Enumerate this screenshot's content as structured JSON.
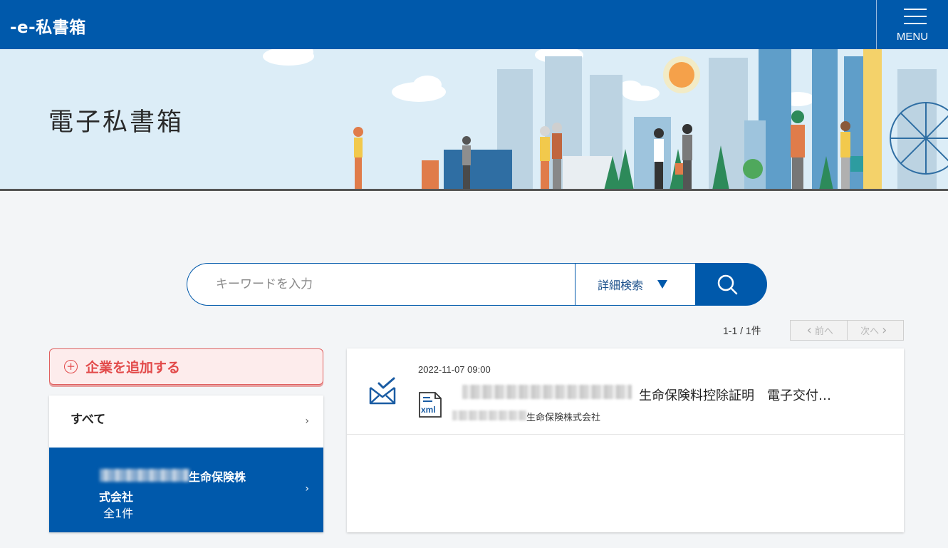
{
  "header": {
    "logo": "-e-私書箱",
    "menu_label": "MENU"
  },
  "hero": {
    "title": "電子私書箱"
  },
  "search": {
    "placeholder": "キーワードを入力",
    "detail_label": "詳細検索"
  },
  "results": {
    "count": "1-1 / 1件",
    "prev_label": "前へ",
    "next_label": "次へ"
  },
  "sidebar": {
    "add_company_label": "企業を追加する",
    "all_label": "すべて",
    "selected_company": {
      "name_line1": "生命保険株",
      "name_line2": "式会社",
      "count": "全1件"
    }
  },
  "documents": [
    {
      "date": "2022-11-07 09:00",
      "title": "生命保険料控除証明　電子交付…",
      "company": "生命保険株式会社",
      "file_type": "xml"
    }
  ],
  "colors": {
    "brand": "#0059ab",
    "add_accent": "#e24a4a",
    "hero_bg": "#dcedf7"
  }
}
